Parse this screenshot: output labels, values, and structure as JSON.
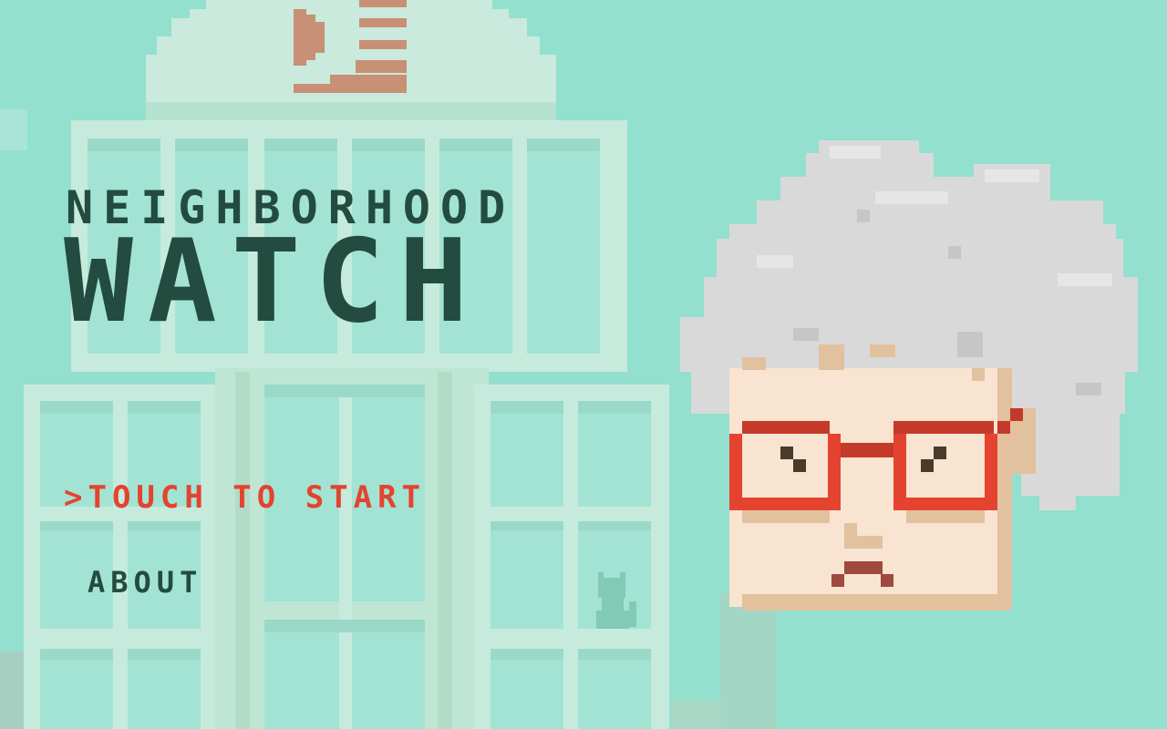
{
  "game": {
    "title_line1": "NEIGHBORHOOD",
    "title_line2": "WATCH"
  },
  "menu": {
    "start_label": ">TOUCH TO START",
    "about_label": "ABOUT",
    "selected": "start"
  },
  "colors": {
    "background": "#93e0cf",
    "title": "#234b3f",
    "menu_selected": "#e4432f",
    "menu_default": "#234b3f",
    "building": "#c7eadb",
    "window_glass": "#a3e3d3",
    "glasses_red": "#e4432f",
    "hair_gray": "#d9d9d9",
    "skin": "#f7e4d0"
  },
  "scene": {
    "background_icons": [
      "building-icon",
      "cat-icon",
      "sign-icon"
    ],
    "character_icon": "grandma-with-glasses-icon"
  }
}
